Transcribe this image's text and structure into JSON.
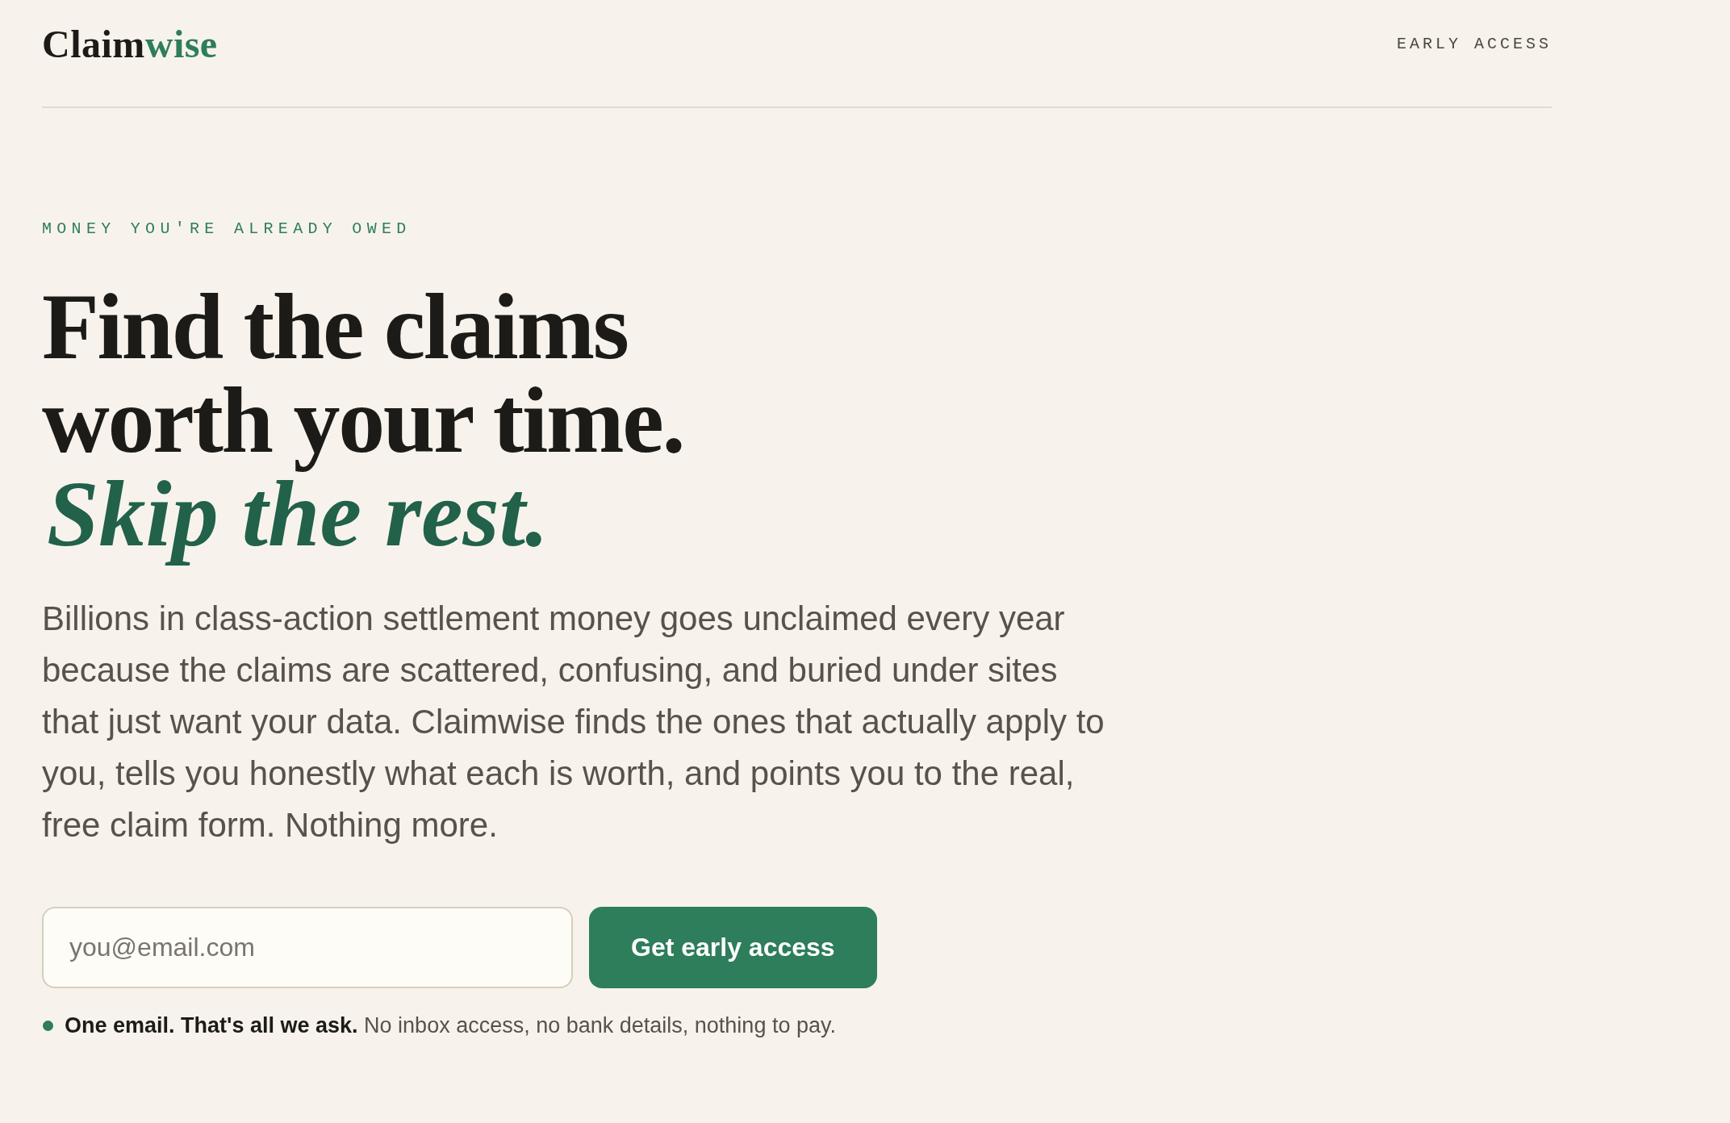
{
  "header": {
    "logo": {
      "primary": "Claim",
      "accent": "wise"
    },
    "tag": "EARLY ACCESS"
  },
  "hero": {
    "eyebrow": "MONEY YOU'RE ALREADY OWED",
    "headline": [
      {
        "text": "Find the claims",
        "kind": "plain"
      },
      {
        "text": "worth your time.",
        "kind": "plain"
      },
      {
        "text": "Skip the rest.",
        "kind": "accent"
      }
    ],
    "body": [
      "Billions in class-action settlement money goes unclaimed every year",
      "because the claims are scattered, confusing, and buried under sites",
      "that just want your data. Claimwise finds the ones that actually apply to",
      "you, tells you honestly what each is worth, and points you to the real,",
      "free claim form. Nothing more."
    ],
    "signup": {
      "email": {
        "placeholder": "you@email.com"
      },
      "button": "Get early access"
    },
    "note": "**One email. That's all we ask.** No inbox access, no bank details, nothing to pay."
  }
}
